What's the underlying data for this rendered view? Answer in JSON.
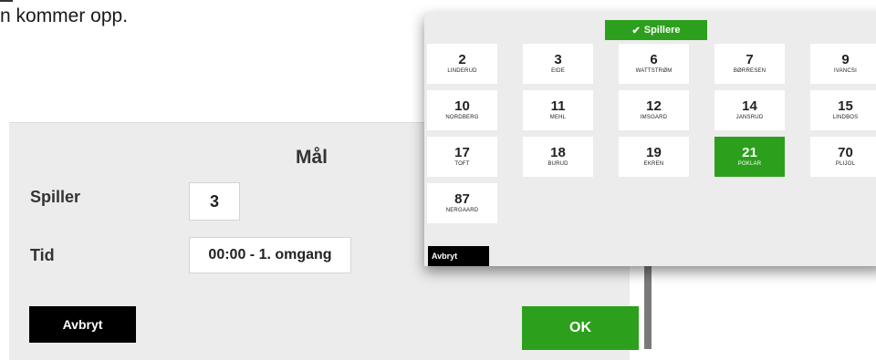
{
  "caption": {
    "text": "n kommer opp."
  },
  "goal_dialog": {
    "title": "Mål",
    "player_label": "Spiller",
    "player_value": "3",
    "time_label": "Tid",
    "time_value": "00:00 - 1. omgang",
    "cancel_label": "Avbryt",
    "ok_label": "OK"
  },
  "picker": {
    "header_label": "Spillere",
    "header_icon": "check-icon",
    "cancel_label": "Avbryt",
    "selected_number": "21",
    "players": [
      {
        "number": "2",
        "name": "LINDERUD"
      },
      {
        "number": "3",
        "name": "EIDE"
      },
      {
        "number": "6",
        "name": "WATTSTRØM"
      },
      {
        "number": "7",
        "name": "BØRRESEN"
      },
      {
        "number": "9",
        "name": "IVANCSI"
      },
      {
        "number": "10",
        "name": "NORDBERG"
      },
      {
        "number": "11",
        "name": "MEHL"
      },
      {
        "number": "12",
        "name": "IMSGARD"
      },
      {
        "number": "14",
        "name": "JANSRUD"
      },
      {
        "number": "15",
        "name": "LINDBOS"
      },
      {
        "number": "17",
        "name": "TOFT"
      },
      {
        "number": "18",
        "name": "BURUD"
      },
      {
        "number": "19",
        "name": "EKREN"
      },
      {
        "number": "21",
        "name": "POKLAR"
      },
      {
        "number": "70",
        "name": "PLIJOL"
      },
      {
        "number": "87",
        "name": "NERGAARD"
      }
    ]
  },
  "colors": {
    "accent": "#2ca01c",
    "button_dark": "#000000",
    "panel": "#ececec"
  }
}
